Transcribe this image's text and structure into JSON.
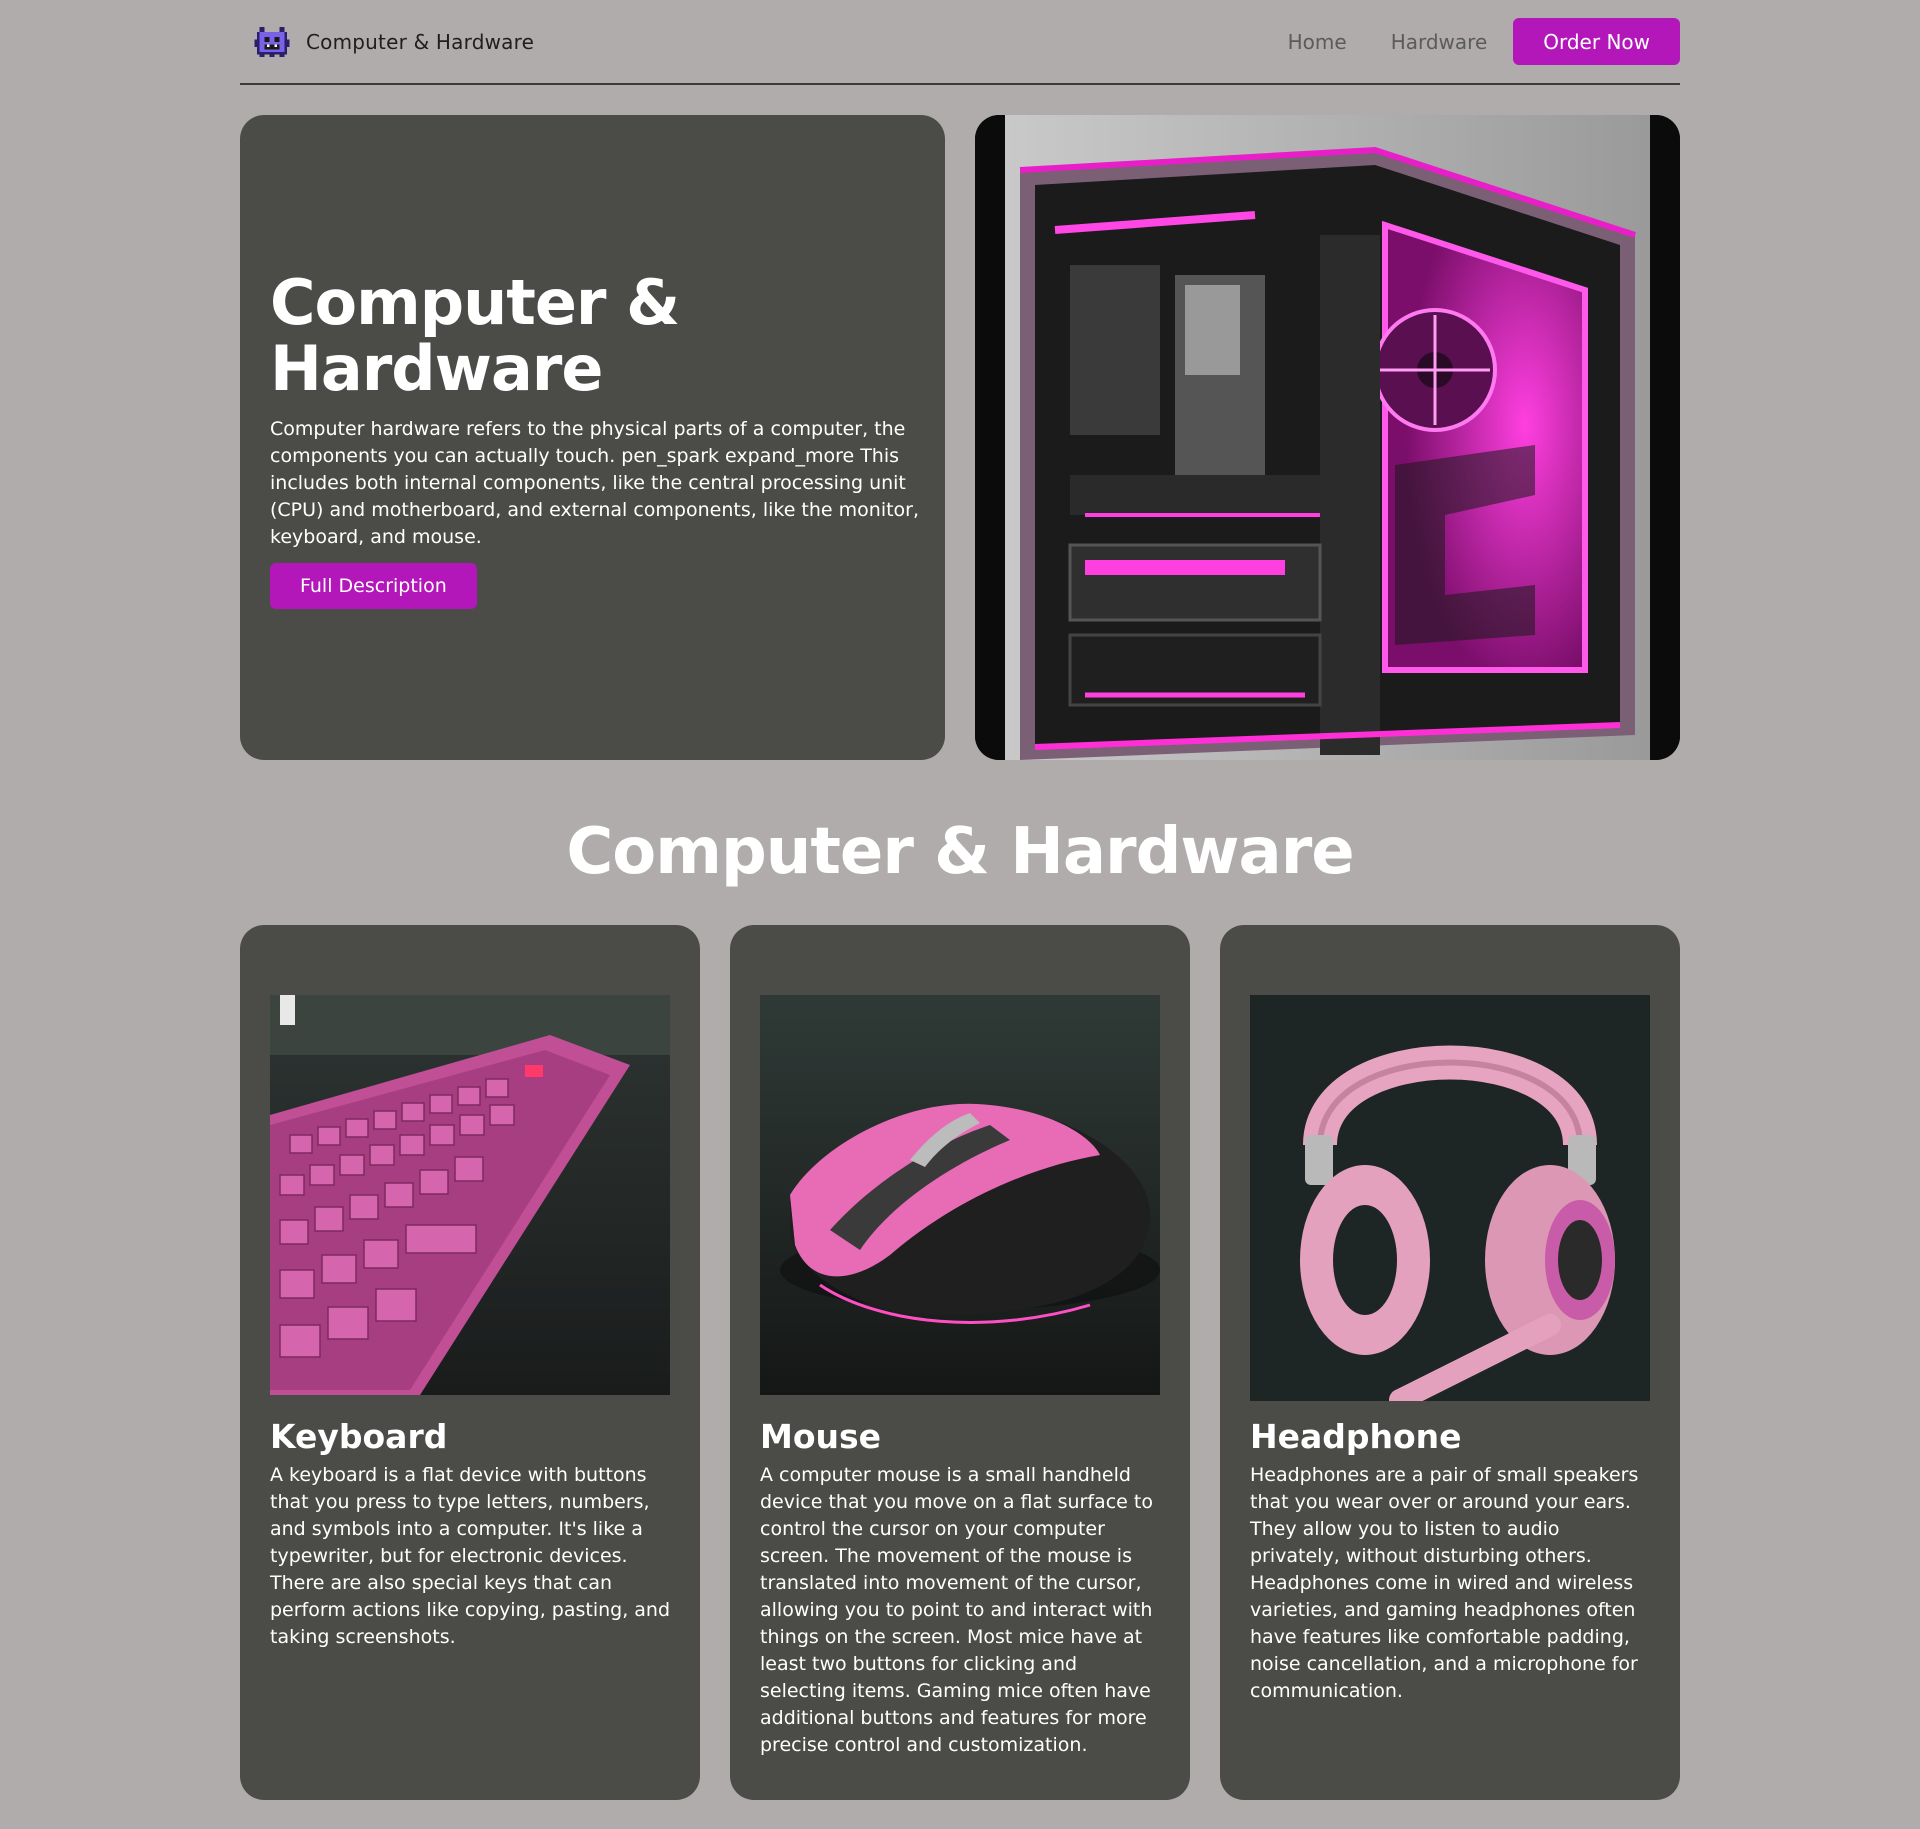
{
  "nav": {
    "brand": "Computer & Hardware",
    "links": [
      "Home",
      "Hardware"
    ],
    "cta": "Order Now"
  },
  "hero": {
    "title": "Computer & Hardware",
    "text": "Computer hardware refers to the physical parts of a computer, the components you can actually touch. pen_spark expand_more This includes both internal components, like the central processing unit (CPU) and motherboard, and external components, like the monitor, keyboard, and mouse.",
    "button": "Full Description",
    "image_alt": "pink-lit-pc-case"
  },
  "section": {
    "title": "Computer & Hardware"
  },
  "cards": [
    {
      "title": "Keyboard",
      "text": "A keyboard is a flat device with buttons that you press to type letters, numbers, and symbols into a computer. It's like a typewriter, but for electronic devices. There are also special keys that can perform actions like copying, pasting, and taking screenshots."
    },
    {
      "title": "Mouse",
      "text": "A computer mouse is a small handheld device that you move on a flat surface to control the cursor on your computer screen. The movement of the mouse is translated into movement of the cursor, allowing you to point to and interact with things on the screen. Most mice have at least two buttons for clicking and selecting items. Gaming mice often have additional buttons and features for more precise control and customization."
    },
    {
      "title": "Headphone",
      "text": "Headphones are a pair of small speakers that you wear over or around your ears. They allow you to listen to audio privately, without disturbing others. Headphones come in wired and wireless varieties, and gaming headphones often have features like comfortable padding, noise cancellation, and a microphone for communication."
    }
  ],
  "colors": {
    "page_bg": "#afacab",
    "card_bg": "#4b4b48",
    "accent": "#b417b9",
    "neon_pink": "#e81fc8"
  }
}
